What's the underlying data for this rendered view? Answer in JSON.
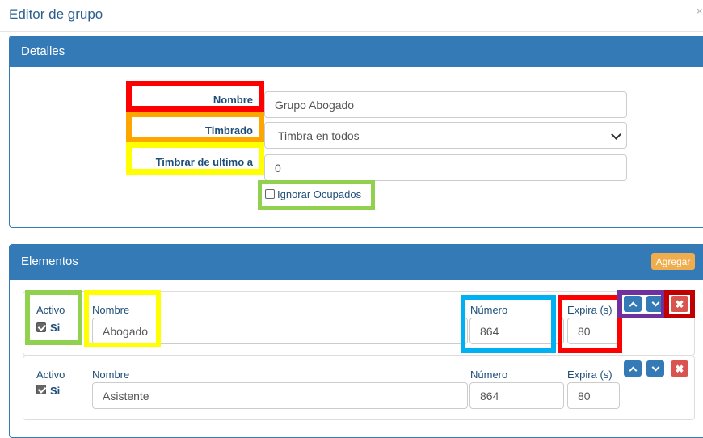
{
  "modal": {
    "title": "Editor de grupo",
    "close": "×"
  },
  "detalles": {
    "heading": "Detalles",
    "nombre_label": "Nombre",
    "nombre_value": "Grupo Abogado",
    "timbrado_label": "Timbrado",
    "timbrado_value": "Timbra en todos",
    "timbrar_ultimo_label": "Timbrar de ultimo a",
    "timbrar_ultimo_value": "0",
    "ignorar_label": "Ignorar Ocupados",
    "ignorar_checked": false
  },
  "elementos": {
    "heading": "Elementos",
    "agregar_label": "Agregar",
    "rows": [
      {
        "activo_label": "Activo",
        "si_label": "Si",
        "activo_checked": true,
        "nombre_label": "Nombre",
        "nombre_value": "Abogado",
        "numero_label": "Número",
        "numero_value": "864",
        "expira_label": "Expira (s)",
        "expira_value": "80"
      },
      {
        "activo_label": "Activo",
        "si_label": "Si",
        "activo_checked": true,
        "nombre_label": "Nombre",
        "nombre_value": "Asistente",
        "numero_label": "Número",
        "numero_value": "864",
        "expira_label": "Expira (s)",
        "expira_value": "80"
      }
    ]
  },
  "icons": {
    "move_up": "chevron-up-icon",
    "move_down": "chevron-down-icon",
    "delete": "close-icon",
    "delete_glyph": "✖"
  },
  "colors": {
    "primary": "#337ab7",
    "danger": "#d9534f",
    "warning": "#f0ad4e",
    "highlight_red": "#ff0000",
    "highlight_orange": "#ffa500",
    "highlight_yellow": "#ffff00",
    "highlight_green": "#92d050",
    "highlight_cyan": "#00b0f0",
    "highlight_purple": "#7030a0",
    "highlight_darkred": "#c00000"
  }
}
